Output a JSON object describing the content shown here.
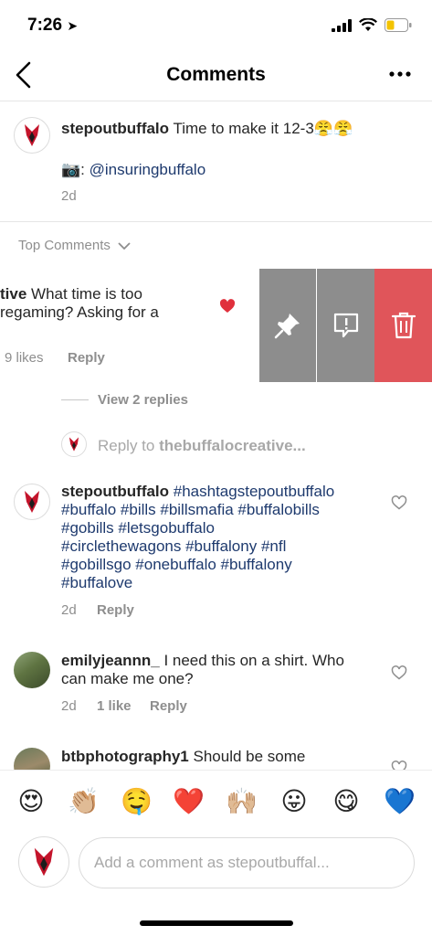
{
  "status": {
    "time": "7:26"
  },
  "nav": {
    "title": "Comments"
  },
  "caption": {
    "username": "stepoutbuffalo",
    "text": " Time to make it 12-3",
    "emojis": "😤😤",
    "camera": "📷",
    "mention_prefix": ": ",
    "mention": "@insuringbuffalo",
    "time": "2d"
  },
  "top_comments": {
    "label": "Top Comments"
  },
  "swiped_comment": {
    "username_partial": "tive",
    "text_line1": " What time is too",
    "text_line2": "regaming? Asking for a",
    "likes": "9 likes",
    "reply": "Reply",
    "actions": [
      "pin-icon",
      "report-icon",
      "trash-icon"
    ],
    "delete_color": "#e0555a",
    "action_color": "#8d8d8d"
  },
  "view_replies": "View 2 replies",
  "reply_to": {
    "prefix": "Reply to ",
    "username": "thebuffalocreative..."
  },
  "comments": [
    {
      "username": "stepoutbuffalo",
      "line1": " #hashtagstepoutbuffalo",
      "line2": "#buffalo #bills #billsmafia #buffalobills",
      "line3": "#gobills #letsgobuffalo",
      "line4": "#circlethewagons #buffalony #nfl",
      "line5": "#gobillsgo #onebuffalo #buffalony",
      "line6": "#buffalove",
      "time": "2d",
      "reply": "Reply"
    },
    {
      "username": "emilyjeannn_",
      "line1": " I need this on a shirt. Who",
      "line2": "can make me one?",
      "time": "2d",
      "likes": "1 like",
      "reply": "Reply"
    },
    {
      "username": "btbphotography1",
      "line1": " Should be some"
    }
  ],
  "emoji_bar": [
    "😍",
    "👏🏼",
    "🤤",
    "❤️",
    "🙌🏼",
    "😛",
    "😋",
    "💙"
  ],
  "composer": {
    "placeholder": "Add a comment as stepoutbuffal..."
  },
  "colors": {
    "accent_tag": "#1e3a6e",
    "heart": "#e0303c",
    "text": "#262626",
    "muted": "#8e8e8e"
  }
}
